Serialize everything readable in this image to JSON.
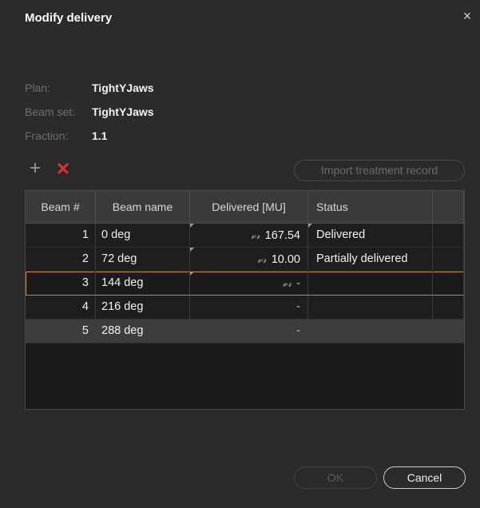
{
  "dialog": {
    "title": "Modify delivery",
    "close_glyph": "×"
  },
  "info": {
    "plan_label": "Plan:",
    "plan_value": "TightYJaws",
    "beamset_label": "Beam set:",
    "beamset_value": "TightYJaws",
    "fraction_label": "Fraction:",
    "fraction_value": "1.1"
  },
  "toolbar": {
    "add_glyph": "+",
    "delete_glyph": "✕",
    "import_label": "Import treatment record"
  },
  "table": {
    "columns": [
      "Beam #",
      "Beam name",
      "Delivered [MU]",
      "Status"
    ],
    "rows": [
      {
        "num": "1",
        "name": "0 deg",
        "delivered": "167.54",
        "status": "Delivered",
        "signed": true
      },
      {
        "num": "2",
        "name": "72 deg",
        "delivered": "10.00",
        "status": "Partially delivered",
        "signed": true
      },
      {
        "num": "3",
        "name": "144 deg",
        "delivered": "-",
        "status": "",
        "signed": true
      },
      {
        "num": "4",
        "name": "216 deg",
        "delivered": "-",
        "status": "",
        "signed": false
      },
      {
        "num": "5",
        "name": "288 deg",
        "delivered": "-",
        "status": "",
        "signed": false
      }
    ],
    "signature_glyph": "𝓋𝓇"
  },
  "footer": {
    "ok_label": "OK",
    "cancel_label": "Cancel"
  },
  "colors": {
    "background": "#2b2b2b",
    "delete_red": "#e0303a",
    "selection_orange": "#c8862a"
  }
}
